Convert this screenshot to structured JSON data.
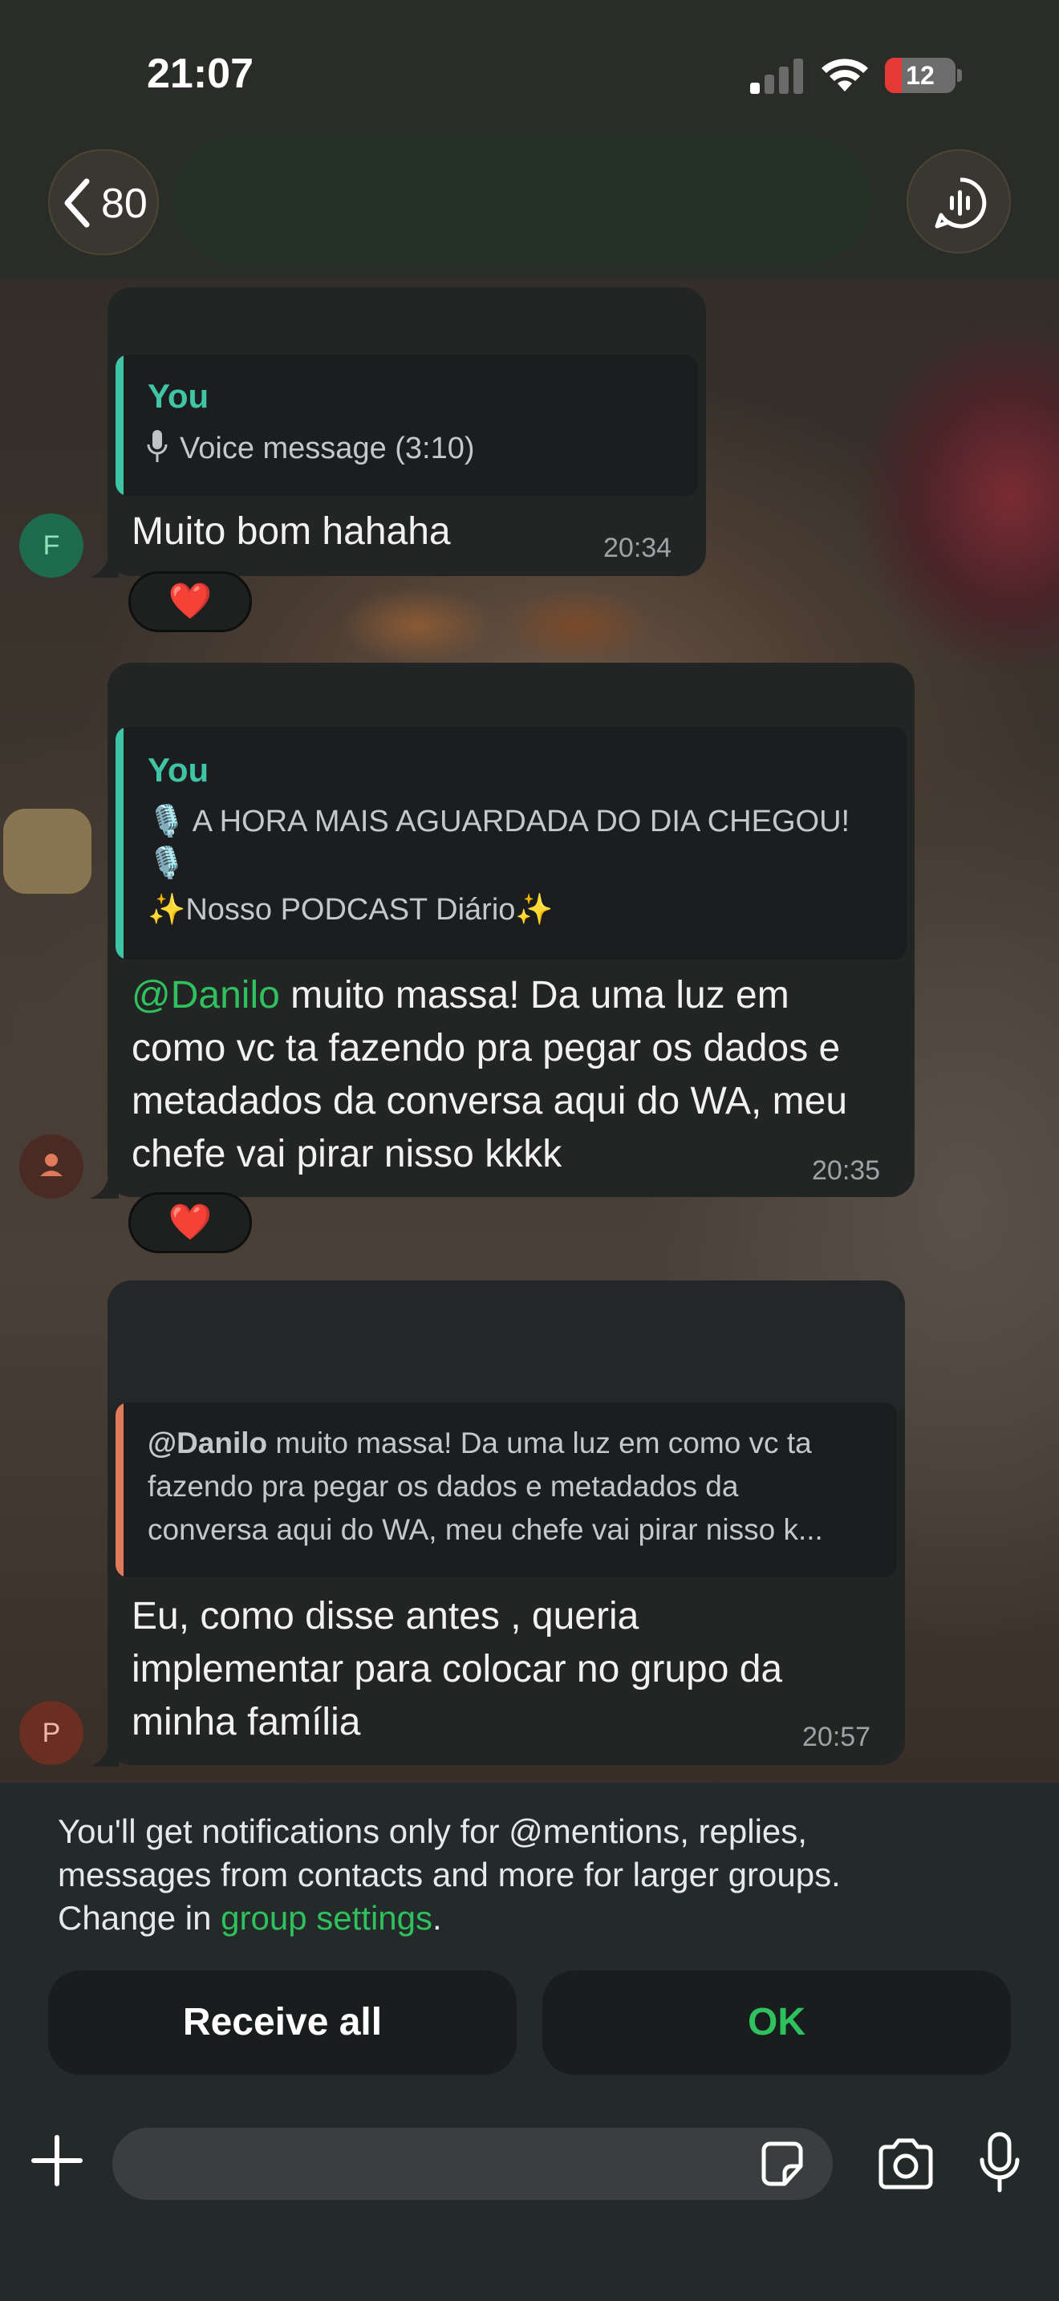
{
  "status_bar": {
    "time": "21:07",
    "battery_level": "12",
    "battery_fraction": 0.12
  },
  "header": {
    "back_count": "80",
    "icons": {
      "back": "chevron-left-icon",
      "call": "voice-chat-icon"
    }
  },
  "messages": [
    {
      "sender_initial": "F",
      "reply": {
        "author": "You",
        "text": "Voice message (3:10)",
        "icon": "microphone-icon"
      },
      "text": "Muito bom hahaha",
      "time": "20:34",
      "reaction": "❤️"
    },
    {
      "sender_initial": "",
      "reply": {
        "author": "You",
        "line1": "🎙️ A HORA MAIS AGUARDADA DO DIA CHEGOU!",
        "line2": "🎙️",
        "line3": "✨Nosso PODCAST Diário✨"
      },
      "mention": "@Danilo",
      "text_line1": " muito massa! Da uma luz em",
      "text_line2": "como vc ta fazendo pra pegar os dados e",
      "text_line3": "metadados da conversa aqui do WA, meu",
      "text_line4": "chefe vai pirar nisso kkkk",
      "time": "20:35",
      "reaction": "❤️"
    },
    {
      "sender_initial": "P",
      "reply": {
        "mention": "@Danilo",
        "line1": " muito massa! Da uma luz em como vc ta",
        "line2": "fazendo pra pegar os dados e metadados da",
        "line3": "conversa aqui do WA, meu chefe vai pirar nisso k..."
      },
      "text_line1": "Eu, como disse antes , queria",
      "text_line2": "implementar para colocar no grupo da",
      "text_line3": "minha família",
      "time": "20:57"
    }
  ],
  "notice": {
    "line1": "You'll get notifications only for @mentions, replies,",
    "line2": "messages from contacts and more for larger groups.",
    "line3_prefix": "Change in ",
    "link": "group settings",
    "line3_suffix": ".",
    "receive_all": "Receive all",
    "ok": "OK"
  },
  "composer": {
    "icons": [
      "plus-icon",
      "sticker-icon",
      "camera-icon",
      "microphone-icon"
    ]
  },
  "colors": {
    "accent_green": "#2fc15d",
    "reply_teal": "#3fc5a5",
    "reply_orange": "#e07a5a",
    "bubble": "#232525"
  }
}
